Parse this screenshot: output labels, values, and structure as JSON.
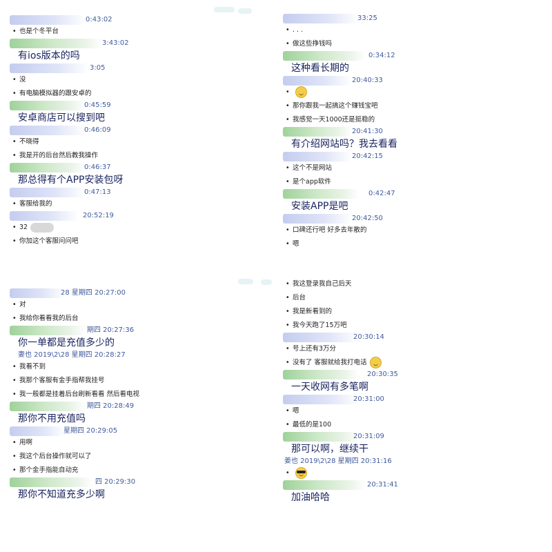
{
  "panels": [
    {
      "messages": [
        {
          "head": "blue",
          "ts": "0:43:02",
          "lines": [
            {
              "t": "也是个冬平台"
            }
          ]
        },
        {
          "head": "green",
          "ts": "3:43:02",
          "lines": [
            {
              "t": "有ios版本的吗",
              "big": true
            }
          ]
        },
        {
          "head": "blue",
          "ts": "3:05",
          "lines": [
            {
              "t": "没"
            },
            {
              "t": "有电脑模拟器的跟安卓的"
            }
          ]
        },
        {
          "head": "green",
          "ts": "0:45:59",
          "lines": [
            {
              "t": "安卓商店可以搜到吧",
              "big": true
            }
          ]
        },
        {
          "head": "blue",
          "ts": "0:46:09",
          "lines": [
            {
              "t": "不晓得"
            },
            {
              "t": "我是开的后台然后教我操作"
            }
          ]
        },
        {
          "head": "green",
          "ts": "0:46:37",
          "lines": [
            {
              "t": "那总得有个APP安装包呀",
              "big": true
            }
          ]
        },
        {
          "head": "blue",
          "ts": "0:47:13",
          "lines": [
            {
              "t": "客服给我的"
            }
          ]
        },
        {
          "head": "blue",
          "ts": "20:52:19",
          "lines": [
            {
              "t": "32",
              "blob": true
            },
            {
              "t": "你加这个客服问问吧"
            }
          ]
        }
      ]
    },
    {
      "messages": [
        {
          "head": "blue",
          "ts": "33:25",
          "lines": [
            {
              "t": ". . ."
            },
            {
              "t": "做这些挣钱吗"
            }
          ]
        },
        {
          "head": "green",
          "ts": "0:34:12",
          "lines": [
            {
              "t": "这种看长期的",
              "big": true
            }
          ]
        },
        {
          "head": "blue",
          "ts": "20:40:33",
          "lines": [
            {
              "t": "",
              "emoji": "smile"
            },
            {
              "t": "那你跟我一起搞这个赚钱宝吧"
            },
            {
              "t": "我感觉一天1000还是挺稳的"
            }
          ]
        },
        {
          "head": "green",
          "ts": "20:41:30",
          "lines": [
            {
              "t": "有介绍网站吗？我去看看",
              "big": true
            }
          ]
        },
        {
          "head": "blue",
          "ts": "20:42:15",
          "lines": [
            {
              "t": "这个不是网站"
            },
            {
              "t": "是个app软件"
            }
          ]
        },
        {
          "head": "green",
          "ts": "0:42:47",
          "lines": [
            {
              "t": "安装APP是吧",
              "big": true
            }
          ]
        },
        {
          "head": "blue",
          "ts": "20:42:50",
          "lines": [
            {
              "t": "口碑还行吧  好多去年散的"
            },
            {
              "t": "嗯"
            }
          ]
        }
      ]
    },
    {
      "messages": [
        {
          "head": "blue",
          "ts": "28 星期四 20:27:00",
          "lines": [
            {
              "t": "对"
            },
            {
              "t": "我给你看看我的后台"
            }
          ]
        },
        {
          "head": "green",
          "ts": "期四 20:27:36",
          "lines": [
            {
              "t": "你一单都是充值多少的",
              "big": true
            }
          ]
        },
        {
          "head": "none",
          "ts": "妻也 2019\\2\\28 星期四 20:28:27",
          "lines": [
            {
              "t": "我看不到"
            },
            {
              "t": "我那个客服有金手指帮我挂号"
            },
            {
              "t": "我一般都是挂着后台刷新看看  然后看电视"
            }
          ]
        },
        {
          "head": "green",
          "ts": "期四 20:28:49",
          "lines": [
            {
              "t": "那你不用充值吗",
              "big": true
            }
          ]
        },
        {
          "head": "blue",
          "ts": "星期四 20:29:05",
          "lines": [
            {
              "t": "用啊"
            },
            {
              "t": "我这个后台操作就可以了"
            },
            {
              "t": "那个金手指能自动充"
            }
          ]
        },
        {
          "head": "green",
          "ts": "四 20:29:30",
          "lines": [
            {
              "t": "那你不知道充多少啊",
              "big": true
            }
          ]
        }
      ]
    },
    {
      "messages": [
        {
          "head": "none",
          "ts": "",
          "lines": [
            {
              "t": "我这登录我自己后天"
            },
            {
              "t": "后台"
            },
            {
              "t": "我是新看到的"
            },
            {
              "t": "我今天跑了15万吧"
            }
          ]
        },
        {
          "head": "blue",
          "ts": "20:30:14",
          "lines": [
            {
              "t": "号上还有3万分"
            },
            {
              "t": "没有了 客服就给我打电话",
              "emoji": "grin"
            }
          ]
        },
        {
          "head": "green",
          "ts": "20:30:35",
          "lines": [
            {
              "t": "一天收网有多笔啊",
              "big": true
            }
          ]
        },
        {
          "head": "blue",
          "ts": "20:31:00",
          "lines": [
            {
              "t": "嗯"
            },
            {
              "t": "最低的是100"
            }
          ]
        },
        {
          "head": "green",
          "ts": "20:31:09",
          "lines": [
            {
              "t": "那可以啊，继续干",
              "big": true
            }
          ]
        },
        {
          "head": "none",
          "ts": "姜也 2019\\2\\28 星期四 20:31:16",
          "lines": [
            {
              "t": "",
              "emoji": "cool"
            }
          ]
        },
        {
          "head": "green",
          "ts": "20:31:41",
          "lines": [
            {
              "t": "加油哈哈",
              "big": true
            }
          ]
        }
      ]
    }
  ]
}
